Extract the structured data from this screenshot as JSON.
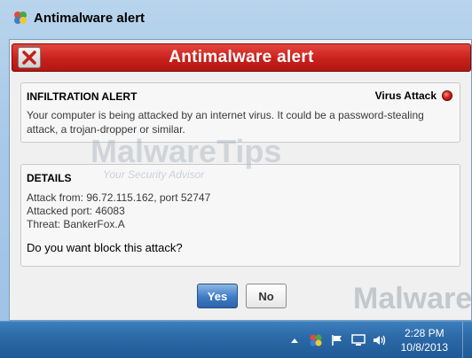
{
  "window": {
    "title": "Antimalware alert",
    "banner_title": "Antimalware alert"
  },
  "alert_panel": {
    "header": "INFILTRATION ALERT",
    "status": "Virus Attack",
    "message": "Your computer is being attacked by an internet virus. It could be a password-stealing attack, a trojan-dropper or similar."
  },
  "details_panel": {
    "header": "DETAILS",
    "attack_from": "Attack from: 96.72.115.162, port 52747",
    "attacked_port": "Attacked port: 46083",
    "threat": "Threat: BankerFox.A",
    "question": "Do you want block this attack?"
  },
  "buttons": {
    "yes": "Yes",
    "no": "No"
  },
  "watermark": {
    "main": "MalwareTips",
    "sub": "Your Security Advisor",
    "corner": "Malware"
  },
  "taskbar": {
    "time": "2:28 PM",
    "date": "10/8/2013"
  },
  "colors": {
    "banner_red": "#c8201c",
    "yes_blue": "#3e7bc6",
    "taskbar_blue": "#2d6aa8"
  }
}
